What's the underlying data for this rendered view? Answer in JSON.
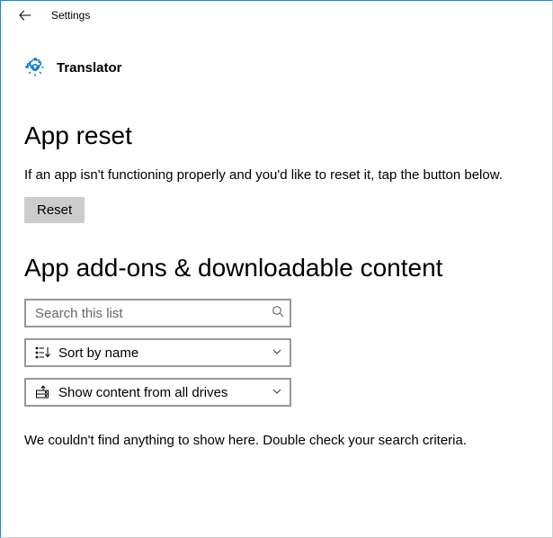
{
  "titlebar": {
    "title": "Settings"
  },
  "app": {
    "name": "Translator"
  },
  "reset_section": {
    "heading": "App reset",
    "description": "If an app isn't functioning properly and you'd like to reset it, tap the button below.",
    "button_label": "Reset"
  },
  "addons_section": {
    "heading": "App add-ons & downloadable content",
    "search_placeholder": "Search this list",
    "sort_label": "Sort by name",
    "filter_label": "Show content from all drives",
    "empty_message": "We couldn't find anything to show here. Double check your search criteria."
  }
}
